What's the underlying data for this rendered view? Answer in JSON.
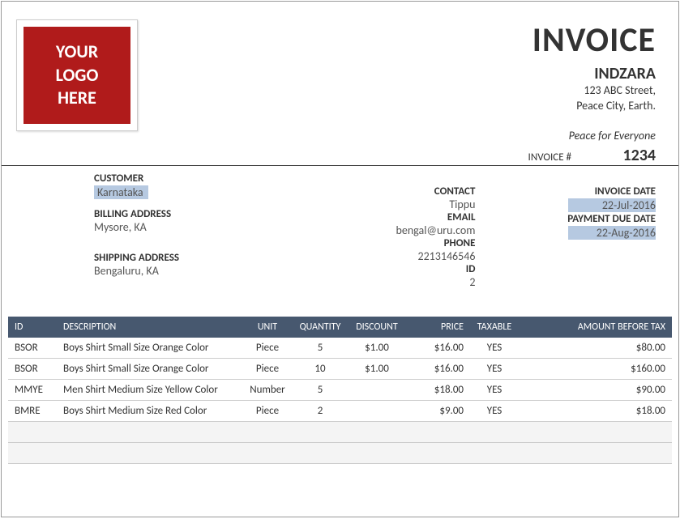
{
  "logo": {
    "line1": "YOUR",
    "line2": "LOGO",
    "line3": "HERE"
  },
  "header": {
    "title": "INVOICE",
    "company": "INDZARA",
    "addr1": "123 ABC Street,",
    "addr2": "Peace City, Earth.",
    "tagline": "Peace for Everyone",
    "invoice_label": "INVOICE #",
    "invoice_number": "1234"
  },
  "customer": {
    "customer_label": "CUSTOMER",
    "customer_value": "Karnataka",
    "billing_label": "BILLING ADDRESS",
    "billing_value": "Mysore, KA",
    "shipping_label": "SHIPPING ADDRESS",
    "shipping_value": "Bengaluru, KA"
  },
  "contact": {
    "contact_label": "CONTACT",
    "contact_value": "Tippu",
    "email_label": "EMAIL",
    "email_value": "bengal@uru.com",
    "phone_label": "PHONE",
    "phone_value": "2213146546",
    "id_label": "ID",
    "id_value": "2"
  },
  "dates": {
    "invoice_date_label": "INVOICE DATE",
    "invoice_date_value": "22-Jul-2016",
    "due_date_label": "PAYMENT DUE DATE",
    "due_date_value": "22-Aug-2016"
  },
  "table": {
    "headers": {
      "id": "ID",
      "description": "DESCRIPTION",
      "unit": "UNIT",
      "quantity": "QUANTITY",
      "discount": "DISCOUNT",
      "price": "PRICE",
      "taxable": "TAXABLE",
      "amount": "AMOUNT BEFORE TAX"
    },
    "rows": [
      {
        "id": "BSOR",
        "description": "Boys Shirt Small Size Orange Color",
        "unit": "Piece",
        "quantity": "5",
        "discount": "$1.00",
        "price": "$16.00",
        "taxable": "YES",
        "amount": "$80.00"
      },
      {
        "id": "BSOR",
        "description": "Boys Shirt Small Size Orange Color",
        "unit": "Piece",
        "quantity": "10",
        "discount": "$1.00",
        "price": "$16.00",
        "taxable": "YES",
        "amount": "$160.00"
      },
      {
        "id": "MMYE",
        "description": "Men Shirt Medium Size Yellow Color",
        "unit": "Number",
        "quantity": "5",
        "discount": "",
        "price": "$18.00",
        "taxable": "YES",
        "amount": "$90.00"
      },
      {
        "id": "BMRE",
        "description": "Boys Shirt Medium Size Red Color",
        "unit": "Piece",
        "quantity": "2",
        "discount": "",
        "price": "$9.00",
        "taxable": "YES",
        "amount": "$18.00"
      }
    ]
  }
}
